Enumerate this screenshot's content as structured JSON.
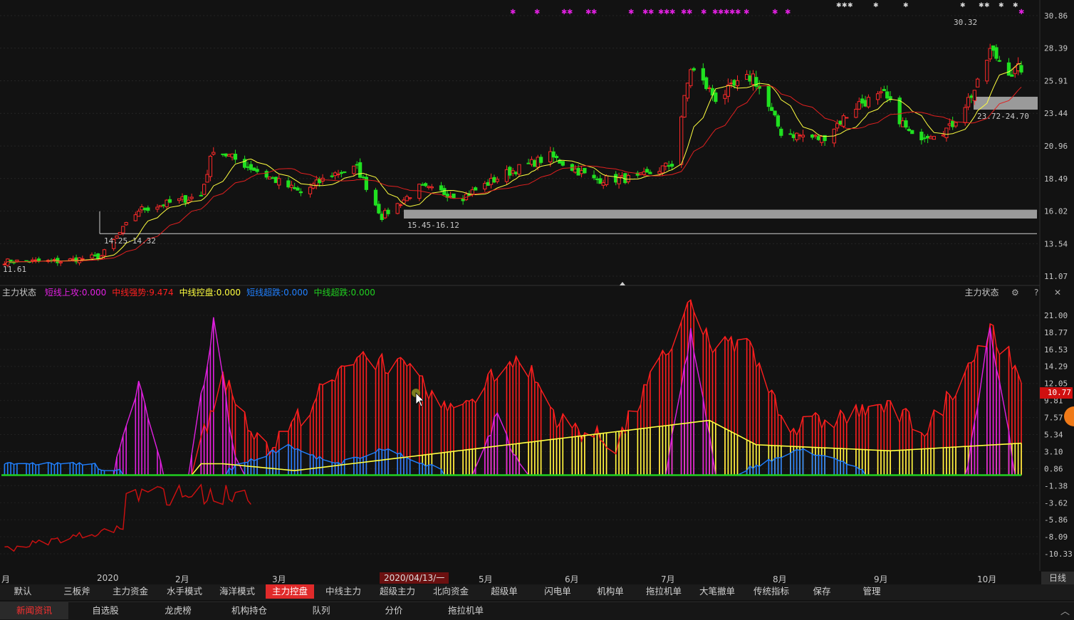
{
  "price_chart": {
    "y_ticks": [
      "30.86",
      "28.39",
      "25.91",
      "23.44",
      "20.96",
      "18.49",
      "16.02",
      "13.54",
      "11.07"
    ],
    "annotations": {
      "low_price": "11.61",
      "high_price": "30.32",
      "zone1": "14.25-14.32",
      "zone2": "15.45-16.12",
      "zone3": "23.72-24.70"
    }
  },
  "indicator": {
    "name": "主力状态",
    "items": [
      {
        "label": "短线上攻:0.000",
        "color": "#e020e0"
      },
      {
        "label": "中线强势:9.474",
        "color": "#ff2020"
      },
      {
        "label": "中线控盘:0.000",
        "color": "#ffff40"
      },
      {
        "label": "短线超跌:0.000",
        "color": "#2080ff"
      },
      {
        "label": "中线超跌:0.000",
        "color": "#20d020"
      }
    ],
    "right_title": "主力状态",
    "icons": [
      "gear-icon",
      "help-icon",
      "close-icon"
    ],
    "y_ticks": [
      "21.00",
      "18.77",
      "16.53",
      "14.29",
      "12.05",
      "9.81",
      "7.57",
      "5.34",
      "3.10",
      "0.86",
      "-1.38",
      "-3.62",
      "-5.86",
      "-8.09",
      "-10.33"
    ],
    "current_value": "10.77"
  },
  "x_axis": {
    "ticks": [
      "月",
      "2020",
      "2月",
      "3月",
      "5月",
      "6月",
      "7月",
      "8月",
      "9月",
      "10月"
    ],
    "cursor_date": "2020/04/13/一",
    "period": "日线"
  },
  "tabs_row1": [
    "默认",
    "三板斧",
    "主力资金",
    "水手模式",
    "海洋模式",
    "主力控盘",
    "中线主力",
    "超级主力",
    "北向资金",
    "超级单",
    "闪电单",
    "机构单",
    "拖拉机单",
    "大笔撤单",
    "传统指标",
    "保存",
    "管理"
  ],
  "tabs_row1_active": "主力控盘",
  "tabs_row2": [
    "新闻资讯",
    "自选股",
    "龙虎榜",
    "机构持仓",
    "队列",
    "分价",
    "拖拉机单"
  ],
  "tabs_row2_active": "新闻资讯",
  "colors": {
    "up": "#ff2a2a",
    "down": "#20e020",
    "ma_short": "#ffff40",
    "ma_long": "#e02020",
    "zone": "#9a9a9a",
    "strong": "#ff1e1e",
    "attack": "#e020e0",
    "control": "#ffff40",
    "oversold_short": "#2080ff",
    "oversold_mid": "#20d020"
  },
  "chart_data": [
    {
      "type": "candlestick",
      "title": "",
      "period": "日线",
      "ylim": [
        11.07,
        30.86
      ],
      "x_range": [
        "2019-12",
        "2020-10"
      ],
      "close_waypoints": [
        {
          "date": "2019-12-20",
          "close": 12.2
        },
        {
          "date": "2020-01-02",
          "close": 12.6
        },
        {
          "date": "2020-01-14",
          "close": 16.1
        },
        {
          "date": "2020-02-03",
          "close": 17.2
        },
        {
          "date": "2020-02-07",
          "close": 20.8
        },
        {
          "date": "2020-02-24",
          "close": 18.7
        },
        {
          "date": "2020-03-06",
          "close": 17.4
        },
        {
          "date": "2020-03-16",
          "close": 18.8
        },
        {
          "date": "2020-03-24",
          "close": 19.3
        },
        {
          "date": "2020-04-01",
          "close": 15.6
        },
        {
          "date": "2020-04-13",
          "close": 17.8
        },
        {
          "date": "2020-04-27",
          "close": 17.1
        },
        {
          "date": "2020-05-11",
          "close": 18.9
        },
        {
          "date": "2020-05-25",
          "close": 20.2
        },
        {
          "date": "2020-06-08",
          "close": 18.4
        },
        {
          "date": "2020-06-22",
          "close": 18.5
        },
        {
          "date": "2020-07-03",
          "close": 19.6
        },
        {
          "date": "2020-07-09",
          "close": 26.9
        },
        {
          "date": "2020-07-17",
          "close": 24.6
        },
        {
          "date": "2020-07-29",
          "close": 26.3
        },
        {
          "date": "2020-08-07",
          "close": 22.0
        },
        {
          "date": "2020-08-20",
          "close": 21.5
        },
        {
          "date": "2020-09-01",
          "close": 24.2
        },
        {
          "date": "2020-09-09",
          "close": 24.8
        },
        {
          "date": "2020-09-18",
          "close": 21.6
        },
        {
          "date": "2020-09-30",
          "close": 22.3
        },
        {
          "date": "2020-10-09",
          "close": 25.6
        },
        {
          "date": "2020-10-13",
          "close": 28.2
        },
        {
          "date": "2020-10-20",
          "close": 26.5
        },
        {
          "date": "2020-10-23",
          "close": 26.9
        }
      ]
    },
    {
      "type": "bar",
      "title": "主力状态",
      "ylim": [
        -10.33,
        21.0
      ],
      "series": [
        {
          "name": "中线强势",
          "waypoints": [
            {
              "x": "2020-02-05",
              "y": 6
            },
            {
              "x": "2020-02-10",
              "y": 13
            },
            {
              "x": "2020-02-24",
              "y": 3
            },
            {
              "x": "2020-03-24",
              "y": 16
            },
            {
              "x": "2020-04-08",
              "y": 14
            },
            {
              "x": "2020-04-23",
              "y": 8
            },
            {
              "x": "2020-05-15",
              "y": 16
            },
            {
              "x": "2020-05-28",
              "y": 7
            },
            {
              "x": "2020-06-15",
              "y": 4
            },
            {
              "x": "2020-07-09",
              "y": 22
            },
            {
              "x": "2020-07-15",
              "y": 17
            },
            {
              "x": "2020-07-28",
              "y": 17
            },
            {
              "x": "2020-08-10",
              "y": 6
            },
            {
              "x": "2020-09-08",
              "y": 9
            },
            {
              "x": "2020-09-23",
              "y": 6
            },
            {
              "x": "2020-10-13",
              "y": 19
            },
            {
              "x": "2020-10-23",
              "y": 13
            }
          ]
        },
        {
          "name": "短线上攻",
          "waypoints": [
            {
              "x": "2020-01-14",
              "y": 12
            },
            {
              "x": "2020-02-07",
              "y": 20
            },
            {
              "x": "2020-05-08",
              "y": 8
            },
            {
              "x": "2020-07-09",
              "y": 19
            },
            {
              "x": "2020-10-13",
              "y": 19
            }
          ]
        },
        {
          "name": "中线控盘",
          "waypoints": [
            {
              "x": "2020-02-10",
              "y": 1.5
            },
            {
              "x": "2020-03-04",
              "y": 0.6
            },
            {
              "x": "2020-07-15",
              "y": 7.2
            },
            {
              "x": "2020-07-30",
              "y": 4.0
            },
            {
              "x": "2020-09-11",
              "y": 3.2
            },
            {
              "x": "2020-10-23",
              "y": 4.2
            }
          ]
        },
        {
          "name": "短线超跌",
          "waypoints": [
            {
              "x": "2019-12-20",
              "y": 1.5
            },
            {
              "x": "2020-03-02",
              "y": 3.5
            },
            {
              "x": "2020-04-01",
              "y": 3.2
            },
            {
              "x": "2020-08-14",
              "y": 3.1
            }
          ]
        },
        {
          "name": "中线超跌",
          "waypoints": [
            {
              "x": "2019-12-01",
              "y": 0
            },
            {
              "x": "2020-10-23",
              "y": 0
            }
          ]
        }
      ]
    }
  ]
}
